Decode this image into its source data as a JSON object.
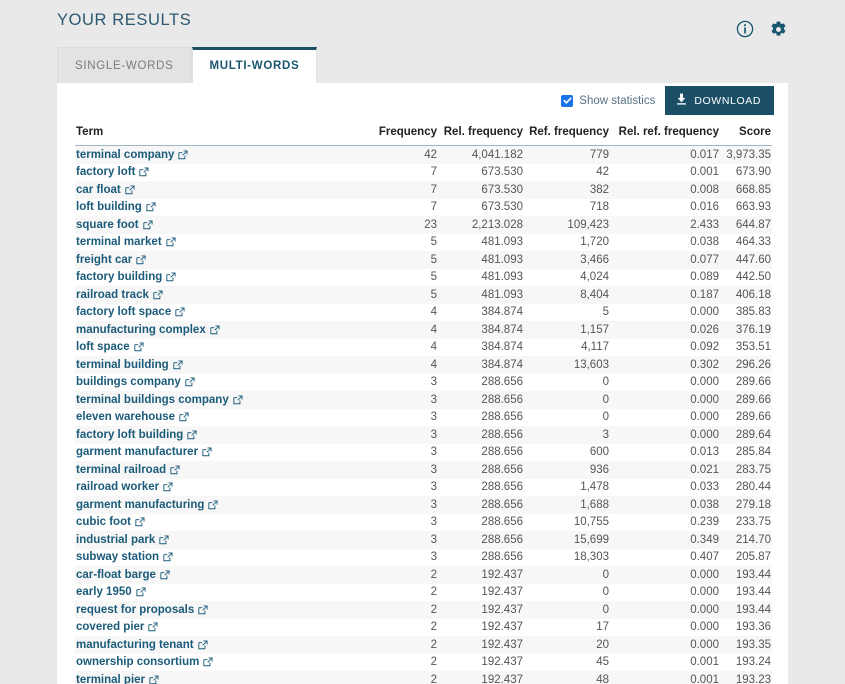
{
  "header": {
    "title": "YOUR RESULTS",
    "icons": [
      {
        "name": "info-icon",
        "label": "Info"
      },
      {
        "name": "gear-icon",
        "label": "Settings"
      }
    ]
  },
  "tabs": [
    {
      "label": "SINGLE-WORDS",
      "active": false
    },
    {
      "label": "MULTI-WORDS",
      "active": true
    }
  ],
  "toolbar": {
    "show_statistics_label": "Show statistics",
    "show_statistics_checked": true,
    "download_label": "DOWNLOAD",
    "download_icon": "download-arrow-icon"
  },
  "colors": {
    "page_background": "#e9e9e9",
    "card_background": "#ffffff",
    "accent_dark": "#1b4f66",
    "link": "#1b5b7a",
    "checkbox": "#1a73e8",
    "title": "#2b5871",
    "row_stripe": "#f7f7f7"
  },
  "table": {
    "columns": [
      "Term",
      "Frequency",
      "Rel. frequency",
      "Ref. frequency",
      "Rel. ref. frequency",
      "Score"
    ],
    "rows": [
      {
        "term": "terminal company",
        "frequency": "42",
        "rel_frequency": "4,041.182",
        "ref_frequency": "779",
        "rel_ref_frequency": "0.017",
        "score": "3,973.35"
      },
      {
        "term": "factory loft",
        "frequency": "7",
        "rel_frequency": "673.530",
        "ref_frequency": "42",
        "rel_ref_frequency": "0.001",
        "score": "673.90"
      },
      {
        "term": "car float",
        "frequency": "7",
        "rel_frequency": "673.530",
        "ref_frequency": "382",
        "rel_ref_frequency": "0.008",
        "score": "668.85"
      },
      {
        "term": "loft building",
        "frequency": "7",
        "rel_frequency": "673.530",
        "ref_frequency": "718",
        "rel_ref_frequency": "0.016",
        "score": "663.93"
      },
      {
        "term": "square foot",
        "frequency": "23",
        "rel_frequency": "2,213.028",
        "ref_frequency": "109,423",
        "rel_ref_frequency": "2.433",
        "score": "644.87"
      },
      {
        "term": "terminal market",
        "frequency": "5",
        "rel_frequency": "481.093",
        "ref_frequency": "1,720",
        "rel_ref_frequency": "0.038",
        "score": "464.33"
      },
      {
        "term": "freight car",
        "frequency": "5",
        "rel_frequency": "481.093",
        "ref_frequency": "3,466",
        "rel_ref_frequency": "0.077",
        "score": "447.60"
      },
      {
        "term": "factory building",
        "frequency": "5",
        "rel_frequency": "481.093",
        "ref_frequency": "4,024",
        "rel_ref_frequency": "0.089",
        "score": "442.50"
      },
      {
        "term": "railroad track",
        "frequency": "5",
        "rel_frequency": "481.093",
        "ref_frequency": "8,404",
        "rel_ref_frequency": "0.187",
        "score": "406.18"
      },
      {
        "term": "factory loft space",
        "frequency": "4",
        "rel_frequency": "384.874",
        "ref_frequency": "5",
        "rel_ref_frequency": "0.000",
        "score": "385.83"
      },
      {
        "term": "manufacturing complex",
        "frequency": "4",
        "rel_frequency": "384.874",
        "ref_frequency": "1,157",
        "rel_ref_frequency": "0.026",
        "score": "376.19"
      },
      {
        "term": "loft space",
        "frequency": "4",
        "rel_frequency": "384.874",
        "ref_frequency": "4,117",
        "rel_ref_frequency": "0.092",
        "score": "353.51"
      },
      {
        "term": "terminal building",
        "frequency": "4",
        "rel_frequency": "384.874",
        "ref_frequency": "13,603",
        "rel_ref_frequency": "0.302",
        "score": "296.26"
      },
      {
        "term": "buildings company",
        "frequency": "3",
        "rel_frequency": "288.656",
        "ref_frequency": "0",
        "rel_ref_frequency": "0.000",
        "score": "289.66"
      },
      {
        "term": "terminal buildings company",
        "frequency": "3",
        "rel_frequency": "288.656",
        "ref_frequency": "0",
        "rel_ref_frequency": "0.000",
        "score": "289.66"
      },
      {
        "term": "eleven warehouse",
        "frequency": "3",
        "rel_frequency": "288.656",
        "ref_frequency": "0",
        "rel_ref_frequency": "0.000",
        "score": "289.66"
      },
      {
        "term": "factory loft building",
        "frequency": "3",
        "rel_frequency": "288.656",
        "ref_frequency": "3",
        "rel_ref_frequency": "0.000",
        "score": "289.64"
      },
      {
        "term": "garment manufacturer",
        "frequency": "3",
        "rel_frequency": "288.656",
        "ref_frequency": "600",
        "rel_ref_frequency": "0.013",
        "score": "285.84"
      },
      {
        "term": "terminal railroad",
        "frequency": "3",
        "rel_frequency": "288.656",
        "ref_frequency": "936",
        "rel_ref_frequency": "0.021",
        "score": "283.75"
      },
      {
        "term": "railroad worker",
        "frequency": "3",
        "rel_frequency": "288.656",
        "ref_frequency": "1,478",
        "rel_ref_frequency": "0.033",
        "score": "280.44"
      },
      {
        "term": "garment manufacturing",
        "frequency": "3",
        "rel_frequency": "288.656",
        "ref_frequency": "1,688",
        "rel_ref_frequency": "0.038",
        "score": "279.18"
      },
      {
        "term": "cubic foot",
        "frequency": "3",
        "rel_frequency": "288.656",
        "ref_frequency": "10,755",
        "rel_ref_frequency": "0.239",
        "score": "233.75"
      },
      {
        "term": "industrial park",
        "frequency": "3",
        "rel_frequency": "288.656",
        "ref_frequency": "15,699",
        "rel_ref_frequency": "0.349",
        "score": "214.70"
      },
      {
        "term": "subway station",
        "frequency": "3",
        "rel_frequency": "288.656",
        "ref_frequency": "18,303",
        "rel_ref_frequency": "0.407",
        "score": "205.87"
      },
      {
        "term": "car-float barge",
        "frequency": "2",
        "rel_frequency": "192.437",
        "ref_frequency": "0",
        "rel_ref_frequency": "0.000",
        "score": "193.44"
      },
      {
        "term": "early 1950",
        "frequency": "2",
        "rel_frequency": "192.437",
        "ref_frequency": "0",
        "rel_ref_frequency": "0.000",
        "score": "193.44"
      },
      {
        "term": "request for proposals",
        "frequency": "2",
        "rel_frequency": "192.437",
        "ref_frequency": "0",
        "rel_ref_frequency": "0.000",
        "score": "193.44"
      },
      {
        "term": "covered pier",
        "frequency": "2",
        "rel_frequency": "192.437",
        "ref_frequency": "17",
        "rel_ref_frequency": "0.000",
        "score": "193.36"
      },
      {
        "term": "manufacturing tenant",
        "frequency": "2",
        "rel_frequency": "192.437",
        "ref_frequency": "20",
        "rel_ref_frequency": "0.000",
        "score": "193.35"
      },
      {
        "term": "ownership consortium",
        "frequency": "2",
        "rel_frequency": "192.437",
        "ref_frequency": "45",
        "rel_ref_frequency": "0.001",
        "score": "193.24"
      },
      {
        "term": "terminal pier",
        "frequency": "2",
        "rel_frequency": "192.437",
        "ref_frequency": "48",
        "rel_ref_frequency": "0.001",
        "score": "193.23"
      }
    ]
  }
}
